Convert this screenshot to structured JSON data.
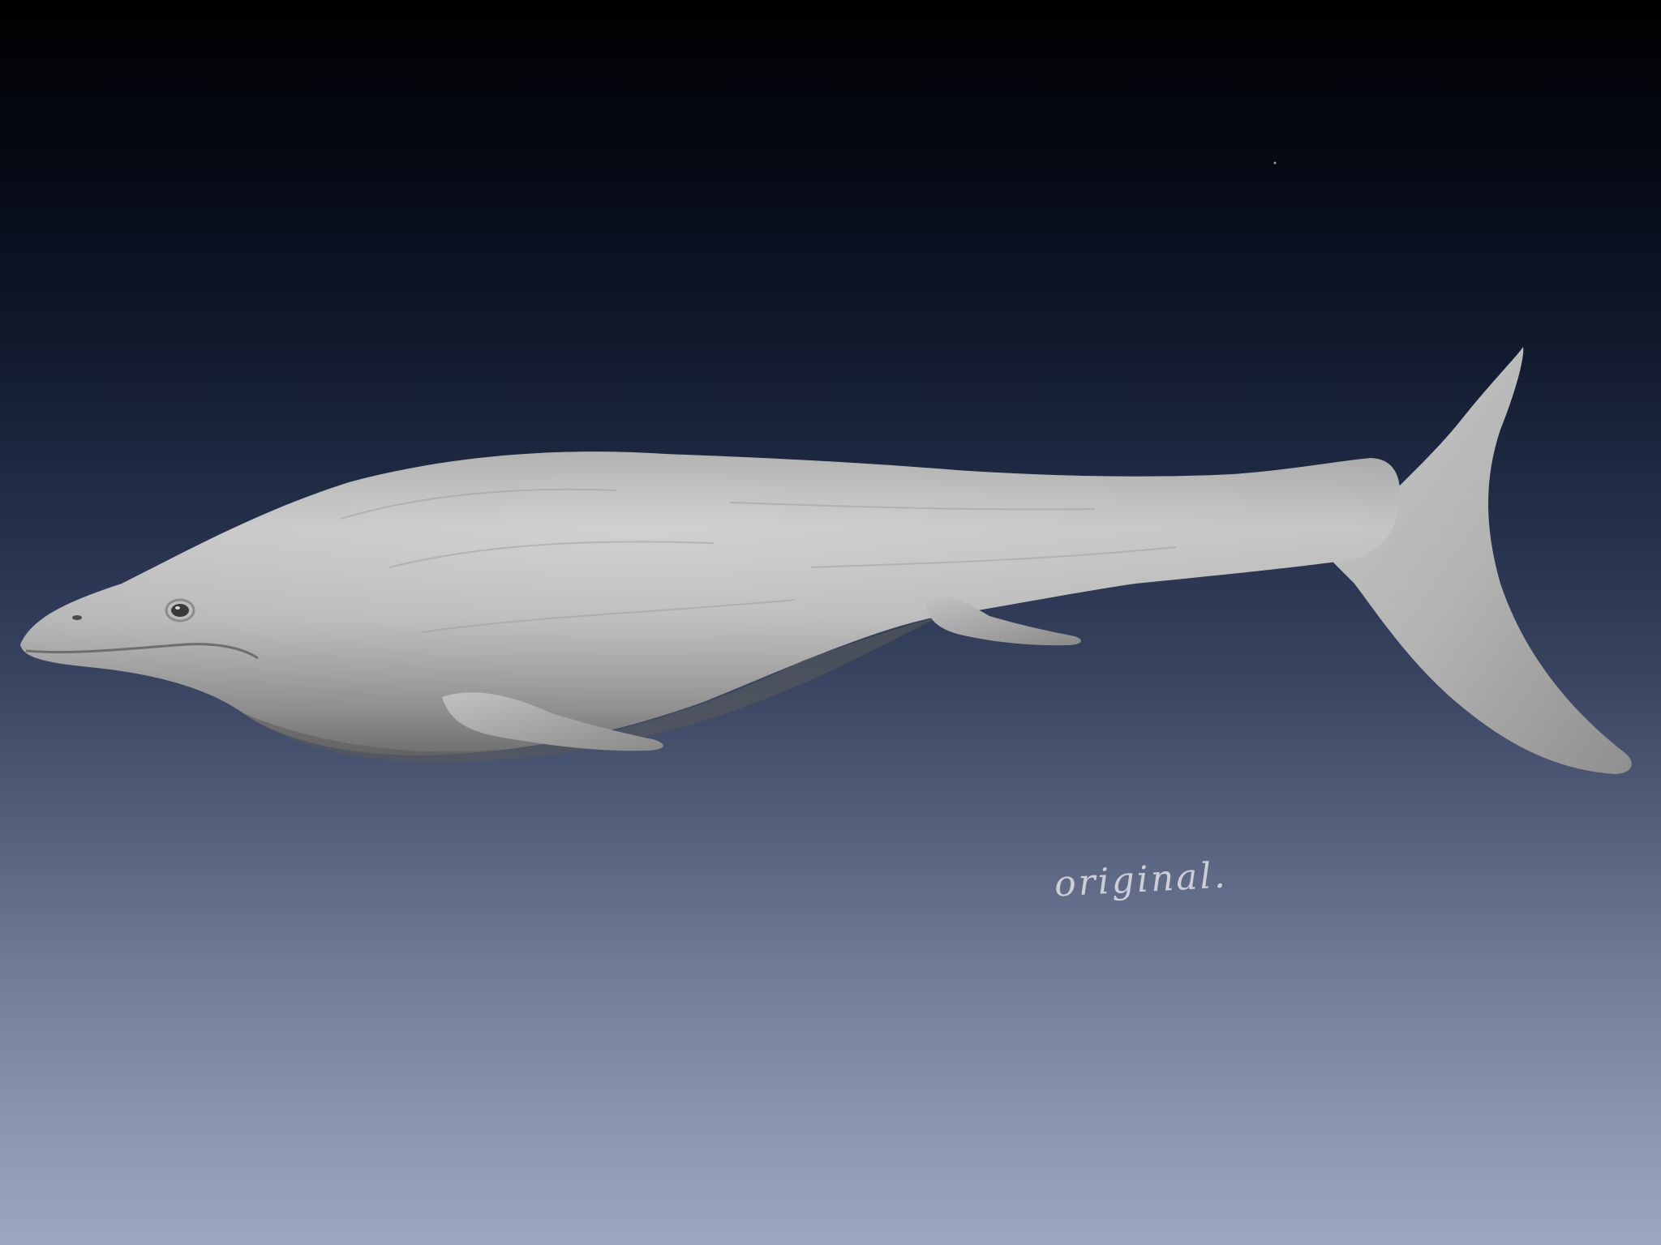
{
  "canvas": {
    "background_top_color": "#000000",
    "background_bottom_color": "#9ca5c2",
    "model_color": "#b9b9b9"
  },
  "subject": {
    "icon": "whale-model-icon"
  },
  "note": {
    "text": "original."
  }
}
